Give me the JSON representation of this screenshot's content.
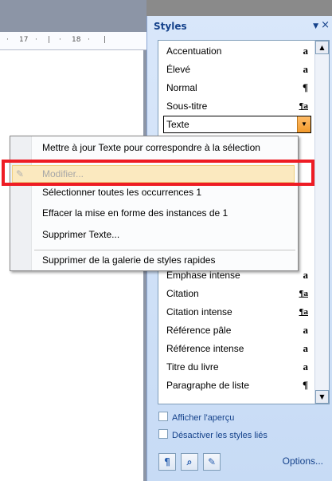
{
  "ruler": {
    "marks": [
      "·",
      "17",
      "·",
      "|",
      "·",
      "18",
      "·",
      "|"
    ]
  },
  "pane": {
    "title": "Styles",
    "dropdown": "▼",
    "close": "×",
    "styles": [
      {
        "label": "Accentuation",
        "glyph": "a"
      },
      {
        "label": "Élevé",
        "glyph": "a"
      },
      {
        "label": "Normal",
        "glyph": "¶"
      },
      {
        "label": "Sous-titre",
        "glyph": "¶a"
      },
      {
        "label": "Texte",
        "glyph": ""
      },
      {
        "label": "Emphase intense",
        "glyph": "a"
      },
      {
        "label": "Citation",
        "glyph": "¶a"
      },
      {
        "label": "Citation intense",
        "glyph": "¶a"
      },
      {
        "label": "Référence pâle",
        "glyph": "a"
      },
      {
        "label": "Référence intense",
        "glyph": "a"
      },
      {
        "label": "Titre du livre",
        "glyph": "a"
      },
      {
        "label": "Paragraphe de liste",
        "glyph": "¶"
      }
    ],
    "show_preview": "Afficher l'aperçu",
    "disable_linked": "Désactiver les styles liés",
    "options": "Options...",
    "tool_icons": [
      "new-style-icon",
      "style-inspector-icon",
      "manage-styles-icon"
    ]
  },
  "context_menu": {
    "items": [
      {
        "label": "Mettre à jour Texte pour correspondre à la sélection",
        "disabled": false
      },
      {
        "label": "Modifier...",
        "disabled": true
      },
      {
        "label": "Sélectionner toutes les occurrences 1",
        "disabled": false
      },
      {
        "label": "Effacer la mise en forme des instances de 1",
        "disabled": false
      },
      {
        "label": "Supprimer Texte...",
        "disabled": false
      },
      {
        "label": "Supprimer de la galerie de styles rapides",
        "disabled": false
      }
    ]
  },
  "colors": {
    "highlight_box": "#ee1c24",
    "pane_title": "#15428b",
    "selected_arrow": "#f29a2b"
  }
}
